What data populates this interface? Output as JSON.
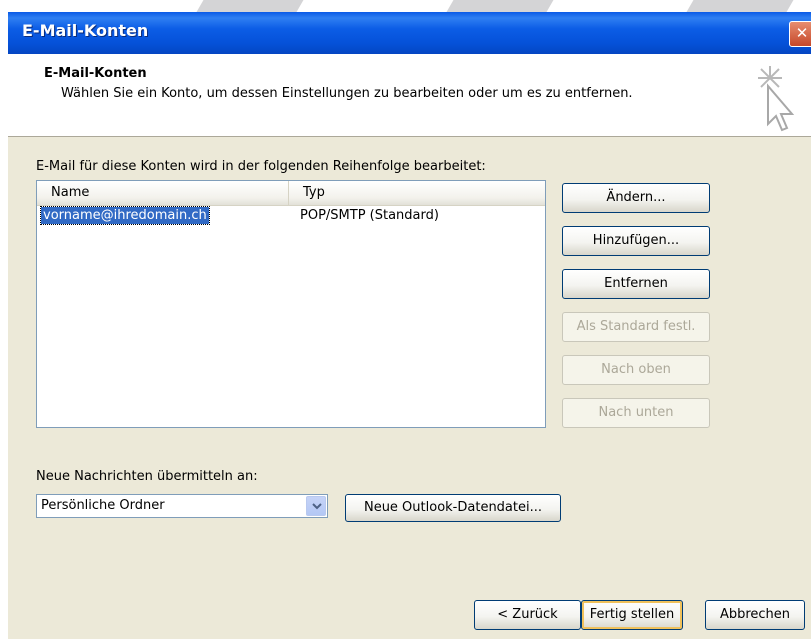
{
  "window": {
    "title": "E-Mail-Konten",
    "close_glyph": "✕"
  },
  "header": {
    "title": "E-Mail-Konten",
    "subtitle": "Wählen Sie ein Konto, um dessen Einstellungen zu bearbeiten oder um es zu entfernen.",
    "icon": "wizard-cursor-icon"
  },
  "accounts": {
    "label": "E-Mail für diese Konten wird in der folgenden Reihenfolge bearbeitet:",
    "columns": [
      "Name",
      "Typ"
    ],
    "rows": [
      {
        "name": "vorname@ihredomain.ch",
        "type": "POP/SMTP (Standard)",
        "selected": true
      }
    ]
  },
  "side_buttons": {
    "change": "Ändern...",
    "add": "Hinzufügen...",
    "remove": "Entfernen",
    "set_default": "Als Standard festl.",
    "move_up": "Nach oben",
    "move_down": "Nach unten"
  },
  "delivery": {
    "label": "Neue Nachrichten übermitteln an:",
    "selected": "Persönliche Ordner",
    "new_data_file": "Neue Outlook-Datendatei..."
  },
  "footer": {
    "back": "< Zurück",
    "finish": "Fertig stellen",
    "cancel": "Abbrechen"
  },
  "colors": {
    "titlebar": "#0551d8",
    "dialog_bg": "#ece9d8",
    "selection": "#316ac5",
    "close_button": "#c6482a"
  }
}
